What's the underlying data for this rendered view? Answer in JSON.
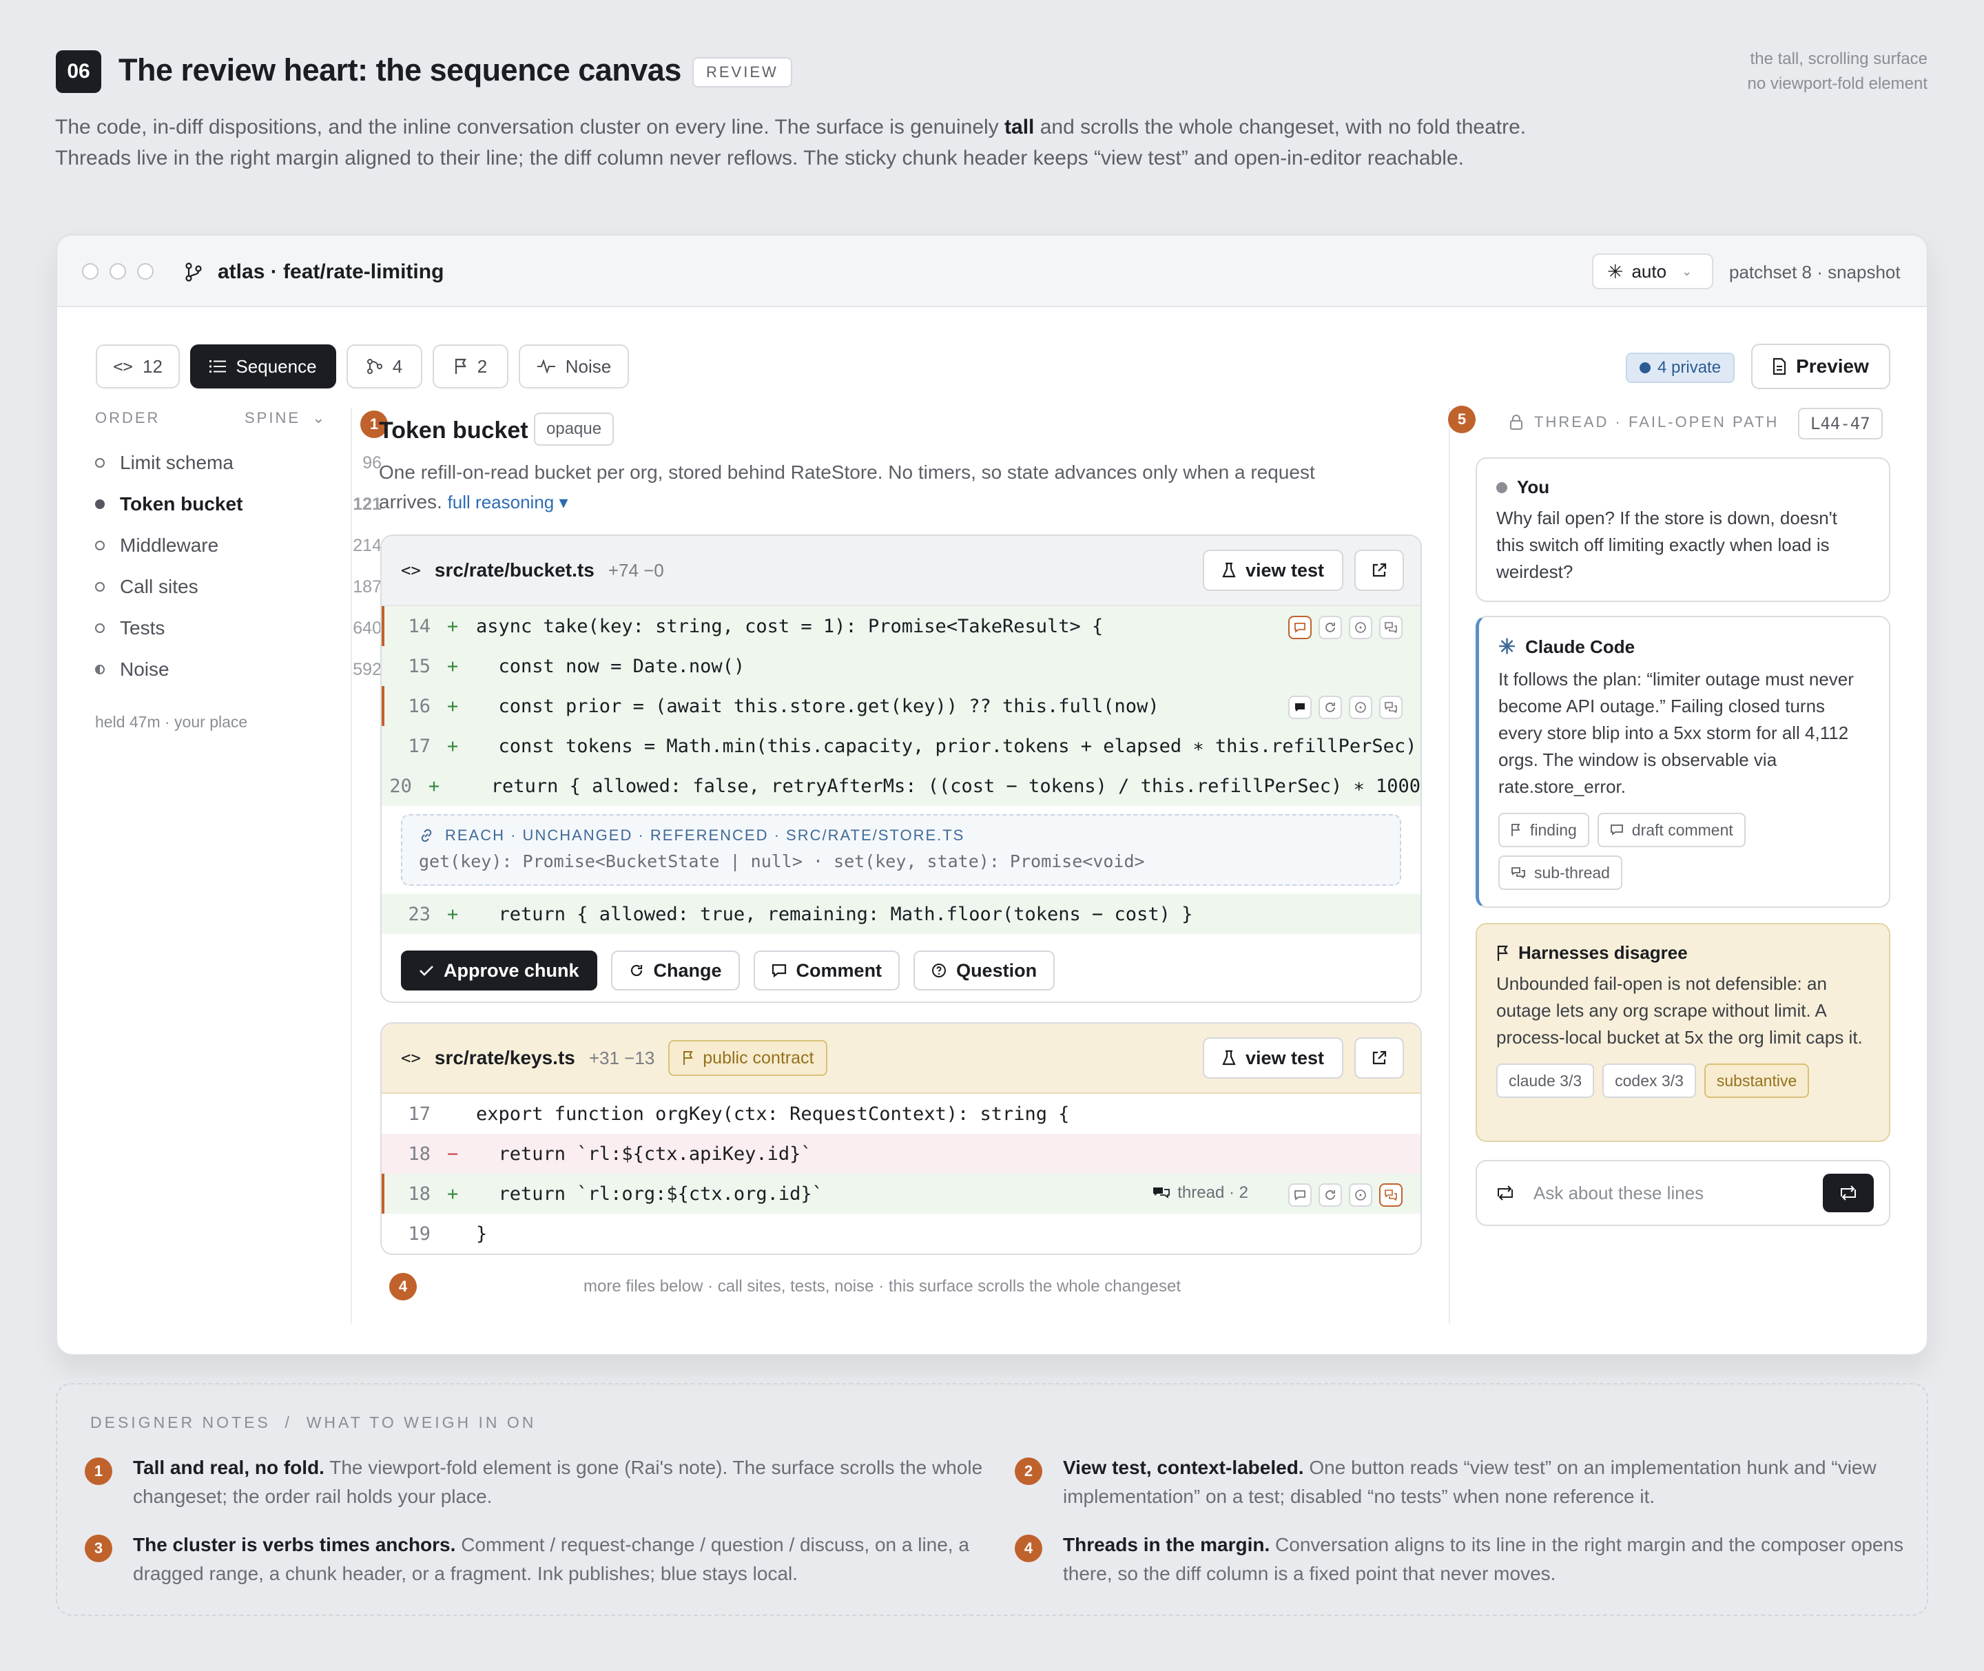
{
  "header": {
    "number": "06",
    "title": "The review heart: the sequence canvas",
    "badge": "REVIEW",
    "right_line1": "the tall, scrolling surface",
    "right_line2": "no viewport-fold element",
    "desc_before": "The code, in-diff dispositions, and the inline conversation cluster on every line. The surface is genuinely ",
    "desc_bold": "tall",
    "desc_after": " and scrolls the whole changeset, with no fold theatre. Threads live in the right margin aligned to their line; the diff column never reflows. The sticky chunk header keeps “view test” and open-in-editor reachable."
  },
  "window": {
    "repo": "atlas · feat/rate-limiting",
    "mode": "auto",
    "patchset": "patchset 8 · snapshot"
  },
  "toolbar": {
    "code_count": "12",
    "sequence": "Sequence",
    "branch_count": "4",
    "flag_count": "2",
    "noise": "Noise",
    "private": "4 private",
    "preview": "Preview"
  },
  "sidebar": {
    "order": "ORDER",
    "spine": "SPINE",
    "items": [
      {
        "label": "Limit schema",
        "count": "96"
      },
      {
        "label": "Token bucket",
        "count": "121"
      },
      {
        "label": "Middleware",
        "count": "214"
      },
      {
        "label": "Call sites",
        "count": "187"
      },
      {
        "label": "Tests",
        "count": "640"
      },
      {
        "label": "Noise",
        "count": "592"
      }
    ],
    "held": "held 47m · your place"
  },
  "chunk": {
    "badge": "1",
    "title": "Token bucket",
    "tag": "opaque",
    "desc": "One refill-on-read bucket per org, stored behind RateStore. No timers, so state advances only when a request arrives.",
    "reasoning": "full reasoning ▾"
  },
  "file1": {
    "path": "src/rate/bucket.ts",
    "stat": "+74 −0",
    "view_test": "view test",
    "lines": [
      {
        "n": "14",
        "s": "+",
        "code": "async take(key: string, cost = 1): Promise<TakeResult> {"
      },
      {
        "n": "15",
        "s": "+",
        "code": "  const now = Date.now()"
      },
      {
        "n": "16",
        "s": "+",
        "code": "  const prior = (await this.store.get(key)) ?? this.full(now)"
      },
      {
        "n": "17",
        "s": "+",
        "code": "  const tokens = Math.min(this.capacity, prior.tokens + elapsed ∗ this.refillPerSec)"
      },
      {
        "n": "20",
        "s": "+",
        "code": "    return { allowed: false, retryAfterMs: ((cost − tokens) / this.refillPerSec) ∗ 1000"
      }
    ],
    "reach_label": "REACH · UNCHANGED · REFERENCED · SRC/RATE/STORE.TS",
    "reach_sig": "get(key): Promise<BucketState | null> · set(key, state): Promise<void>",
    "line23": {
      "n": "23",
      "s": "+",
      "code": "  return { allowed: true, remaining: Math.floor(tokens − cost) }"
    },
    "approve": "Approve chunk",
    "change": "Change",
    "comment": "Comment",
    "question": "Question"
  },
  "file2": {
    "path": "src/rate/keys.ts",
    "stat": "+31 −13",
    "contract": "public contract",
    "view_test": "view test",
    "lines": [
      {
        "n": "17",
        "s": "",
        "code": "export function orgKey(ctx: RequestContext): string {"
      },
      {
        "n": "18",
        "s": "−",
        "code": "  return `rl:${ctx.apiKey.id}`"
      },
      {
        "n": "18",
        "s": "+",
        "code": "  return `rl:org:${ctx.org.id}`"
      },
      {
        "n": "19",
        "s": "",
        "code": "}"
      }
    ],
    "thread_label": "thread · 2"
  },
  "more": "more files below · call sites, tests, noise · this surface scrolls the whole changeset",
  "badges": {
    "b4": "4",
    "b5": "5"
  },
  "thread": {
    "head": "THREAD · FAIL-OPEN PATH",
    "range": "L44-47",
    "you_name": "You",
    "you_text": "Why fail open? If the store is down, doesn't this switch off limiting exactly when load is weirdest?",
    "claude_name": "Claude Code",
    "claude_text": "It follows the plan: “limiter outage must never become API outage.” Failing closed turns every store blip into a 5xx storm for all 4,112 orgs. The window is observable via rate.store_error.",
    "chip_finding": "finding",
    "chip_draft": "draft comment",
    "chip_sub": "sub-thread",
    "harness_name": "Harnesses disagree",
    "harness_text": "Unbounded fail-open is not defensible: an outage lets any org scrape without limit. A process-local bucket at 5x the org limit caps it.",
    "chip_claude": "claude 3/3",
    "chip_codex": "codex 3/3",
    "chip_subst": "substantive",
    "ask_placeholder": "Ask about these lines"
  },
  "notes": {
    "heading": "DESIGNER NOTES  /  WHAT TO WEIGH IN ON",
    "items": [
      {
        "num": "1",
        "bold": "Tall and real, no fold.",
        "text": " The viewport-fold element is gone (Rai's note). The surface scrolls the whole changeset; the order rail holds your place."
      },
      {
        "num": "2",
        "bold": "View test, context-labeled.",
        "text": " One button reads “view test” on an implementation hunk and “view implementation” on a test; disabled “no tests” when none reference it."
      },
      {
        "num": "3",
        "bold": "The cluster is verbs times anchors.",
        "text": " Comment / request-change / question / discuss, on a line, a dragged range, a chunk header, or a fragment. Ink publishes; blue stays local."
      },
      {
        "num": "4",
        "bold": "Threads in the margin.",
        "text": " Conversation aligns to its line in the right margin and the composer opens there, so the diff column is a fixed point that never moves."
      }
    ]
  },
  "colors": {
    "accent": "#c0622c",
    "ink": "#1b1d22",
    "add_bg": "#eef6ee",
    "del_bg": "#fbeef0",
    "private": "#2b5b93"
  }
}
